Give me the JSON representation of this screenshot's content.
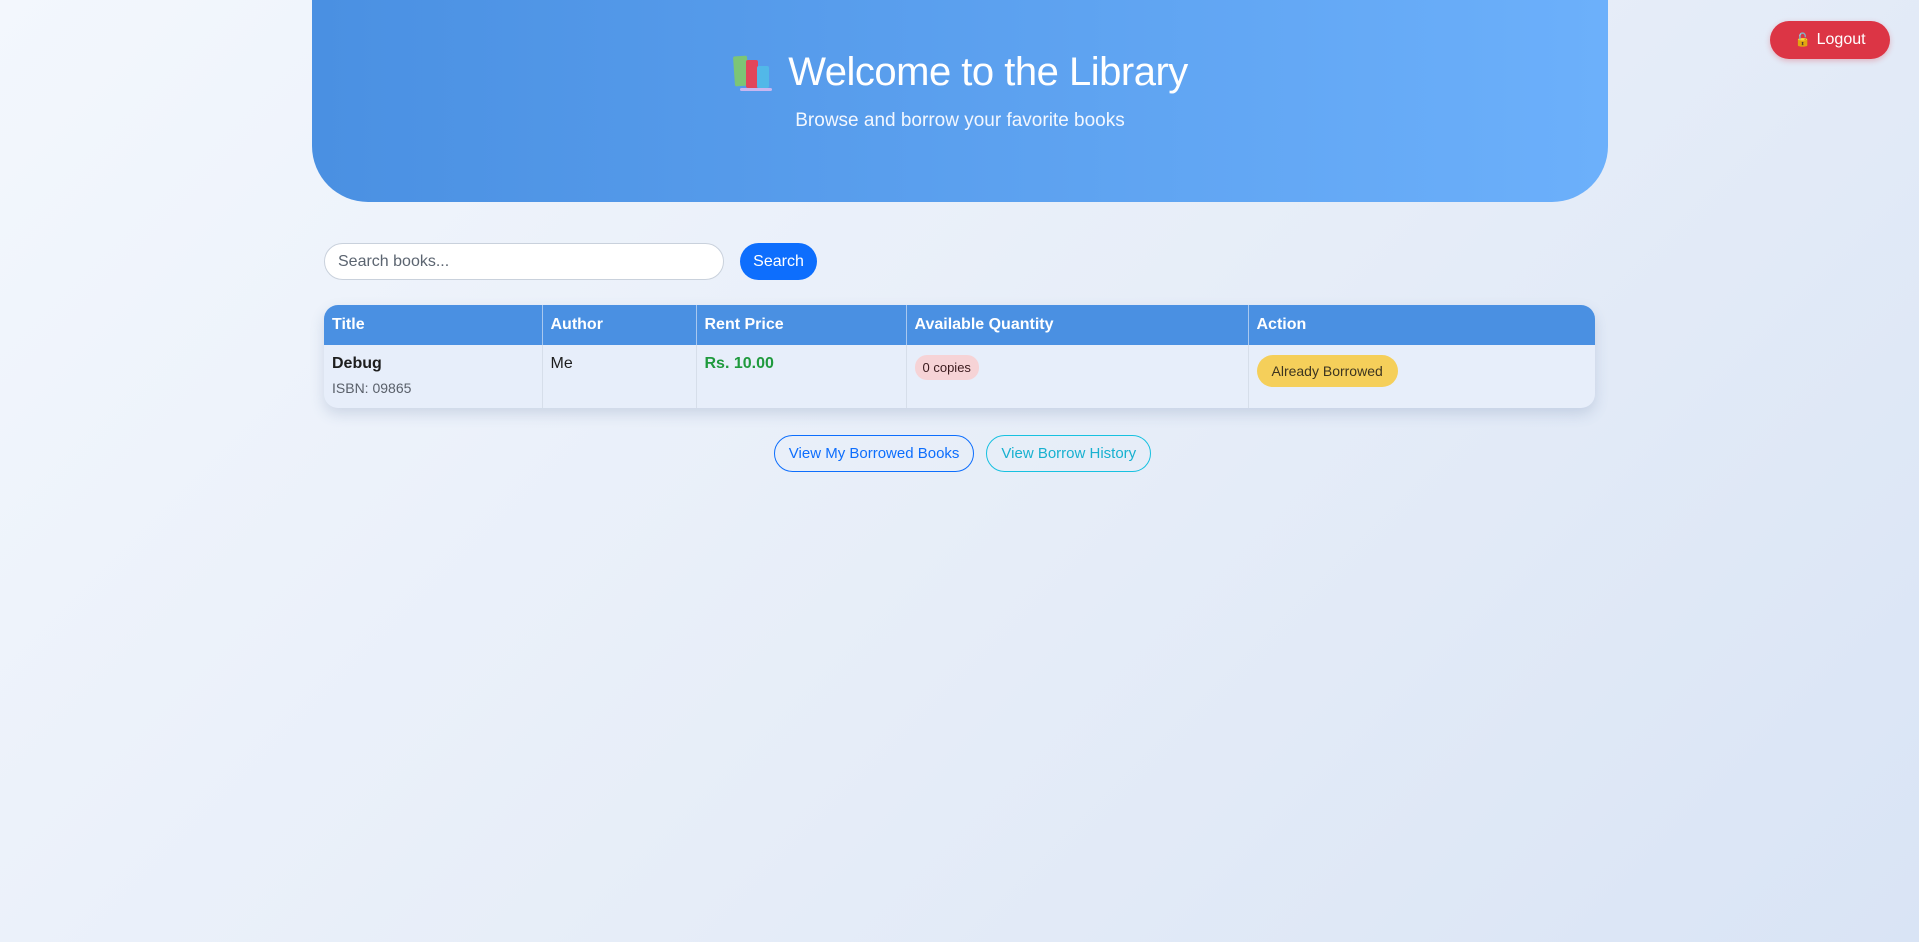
{
  "header": {
    "title": "Welcome to the Library",
    "subtitle": "Browse and borrow your favorite books",
    "icon": "books-icon"
  },
  "logout": {
    "label": "Logout",
    "icon": "lock-icon",
    "color": "#dc3545"
  },
  "search": {
    "placeholder": "Search books...",
    "value": "",
    "button_label": "Search"
  },
  "table": {
    "columns": [
      "Title",
      "Author",
      "Rent Price",
      "Available Quantity",
      "Action"
    ],
    "rows": [
      {
        "title": "Debug",
        "isbn": "ISBN: 09865",
        "author": "Me",
        "price": "Rs. 10.00",
        "quantity": "0 copies",
        "action": "Already Borrowed"
      }
    ]
  },
  "actions": {
    "borrowed_books": "View My Borrowed Books",
    "borrow_history": "View Borrow History"
  },
  "colors": {
    "header_accent": "#4a90e2",
    "primary": "#0d6efd",
    "price": "#1f9a3d",
    "warning": "#f5cf5a"
  }
}
